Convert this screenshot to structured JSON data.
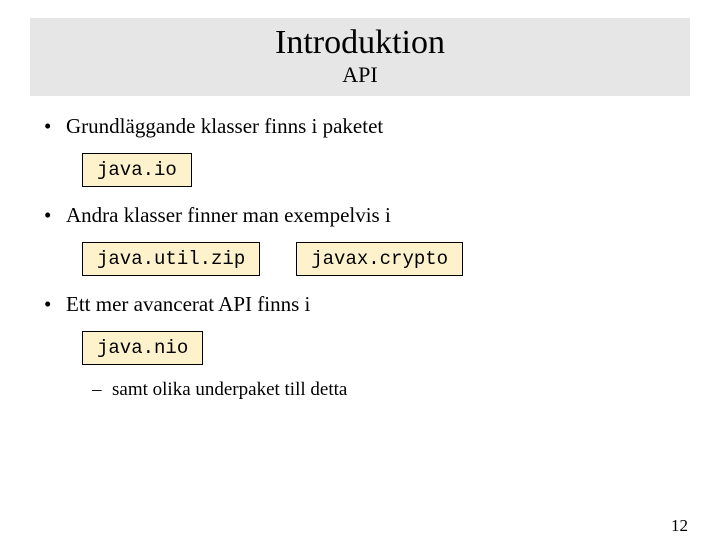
{
  "title": {
    "main": "Introduktion",
    "sub": "API"
  },
  "bullets": {
    "b1": {
      "text": "Grundläggande klasser finns i paketet",
      "codes": [
        "java.io"
      ]
    },
    "b2": {
      "text": "Andra klasser finner man exempelvis i",
      "codes": [
        "java.util.zip",
        "javax.crypto"
      ]
    },
    "b3": {
      "text": "Ett mer avancerat API finns i",
      "codes": [
        "java.nio"
      ],
      "sub": "samt olika underpaket till detta"
    }
  },
  "page_number": "12"
}
